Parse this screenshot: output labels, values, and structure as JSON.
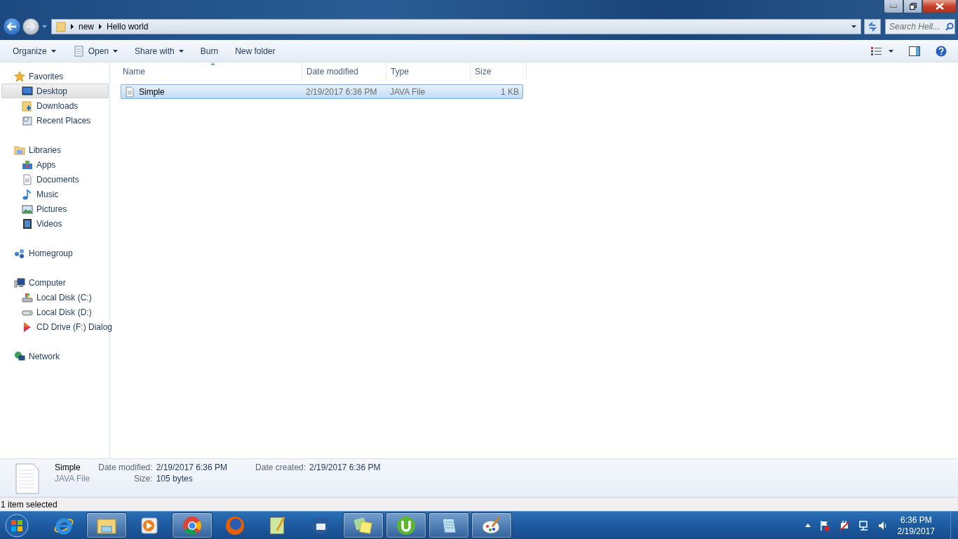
{
  "address_bar": {
    "path": [
      "new",
      "Hello world"
    ]
  },
  "search": {
    "placeholder": "Search Hell..."
  },
  "toolbar": {
    "items": [
      {
        "label": "Organize",
        "kind": "plain",
        "dropdown": true
      },
      {
        "label": "Open",
        "kind": "notepad",
        "dropdown": true
      },
      {
        "label": "Share with",
        "kind": "plain",
        "dropdown": true
      },
      {
        "label": "Burn",
        "kind": "plain",
        "dropdown": false
      },
      {
        "label": "New folder",
        "kind": "plain",
        "dropdown": false
      }
    ]
  },
  "sidebar": {
    "groups": [
      {
        "label": "Favorites",
        "kind": "star",
        "children": [
          {
            "label": "Desktop",
            "kind": "desktop",
            "selected": true
          },
          {
            "label": "Downloads",
            "kind": "downloads",
            "selected": false
          },
          {
            "label": "Recent Places",
            "kind": "recent",
            "selected": false
          }
        ]
      },
      {
        "label": "Libraries",
        "kind": "library",
        "children": [
          {
            "label": "Apps",
            "kind": "apps",
            "selected": false
          },
          {
            "label": "Documents",
            "kind": "document",
            "selected": false
          },
          {
            "label": "Music",
            "kind": "music",
            "selected": false
          },
          {
            "label": "Pictures",
            "kind": "pictures",
            "selected": false
          },
          {
            "label": "Videos",
            "kind": "videos",
            "selected": false
          }
        ]
      },
      {
        "label": "Homegroup",
        "kind": "homegroup"
      },
      {
        "label": "Computer",
        "kind": "computer",
        "children": [
          {
            "label": "Local Disk (C:)",
            "kind": "systemdisk",
            "selected": false
          },
          {
            "label": "Local Disk (D:)",
            "kind": "disk",
            "selected": false
          },
          {
            "label": "CD Drive (F:) Dialog",
            "kind": "cd",
            "selected": false
          }
        ]
      },
      {
        "label": "Network",
        "kind": "network"
      }
    ]
  },
  "file_list": {
    "columns": [
      {
        "label": "Name",
        "sorted": true
      },
      {
        "label": "Date modified",
        "sorted": false
      },
      {
        "label": "Type",
        "sorted": false
      },
      {
        "label": "Size",
        "sorted": false
      }
    ],
    "rows": [
      {
        "cells": [
          "Simple",
          "2/19/2017 6:36 PM",
          "JAVA File",
          "1 KB"
        ],
        "selected": true
      }
    ]
  },
  "details": {
    "name": "Simple",
    "type": "JAVA File",
    "fields": [
      {
        "label": "Date modified:",
        "value": "2/19/2017 6:36 PM"
      },
      {
        "label": "Size:",
        "value": "105 bytes"
      },
      {
        "label": "Date created:",
        "value": "2/19/2017 6:36 PM"
      }
    ]
  },
  "status_bar": {
    "text": "1 item selected"
  },
  "taskbar": {
    "apps": [
      {
        "kind": "ie",
        "running": false
      },
      {
        "kind": "explorer",
        "running": true
      },
      {
        "kind": "mediaplayer",
        "running": false
      },
      {
        "kind": "chrome",
        "running": true
      },
      {
        "kind": "firefox",
        "running": false
      },
      {
        "kind": "notepadpp",
        "running": false
      },
      {
        "kind": "thunderbird",
        "running": false
      },
      {
        "kind": "sticky",
        "running": true
      },
      {
        "kind": "torrent",
        "running": true
      },
      {
        "kind": "notepad",
        "running": true
      },
      {
        "kind": "paint",
        "running": true
      }
    ],
    "clock": {
      "time": "6:36 PM",
      "date": "2/19/2017"
    }
  }
}
